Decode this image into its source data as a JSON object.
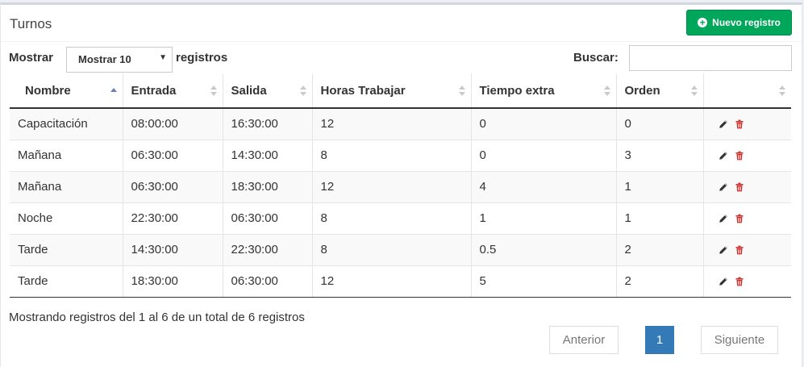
{
  "panel": {
    "title": "Turnos",
    "new_button_label": "Nuevo registro"
  },
  "length": {
    "prefix": "Mostrar",
    "selected": "Mostrar 10",
    "suffix": "registros"
  },
  "search": {
    "label": "Buscar:",
    "value": ""
  },
  "table": {
    "columns": [
      "Nombre",
      "Entrada",
      "Salida",
      "Horas Trabajar",
      "Tiempo extra",
      "Orden",
      ""
    ],
    "sorted_column": "Nombre",
    "sort_direction": "asc",
    "rows": [
      [
        "Capacitación",
        "08:00:00",
        "16:30:00",
        "12",
        "0",
        "0"
      ],
      [
        "Mañana",
        "06:30:00",
        "14:30:00",
        "8",
        "0",
        "3"
      ],
      [
        "Mañana",
        "06:30:00",
        "18:30:00",
        "12",
        "4",
        "1"
      ],
      [
        "Noche",
        "22:30:00",
        "06:30:00",
        "8",
        "1",
        "1"
      ],
      [
        "Tarde",
        "14:30:00",
        "22:30:00",
        "8",
        "0.5",
        "2"
      ],
      [
        "Tarde",
        "18:30:00",
        "06:30:00",
        "12",
        "5",
        "2"
      ]
    ],
    "row_actions": [
      "pencil-icon",
      "trash-icon"
    ]
  },
  "footer": {
    "info": "Mostrando registros del 1 al 6 de un total de 6 registros",
    "prev_label": "Anterior",
    "current_page": "1",
    "next_label": "Siguiente"
  },
  "colors": {
    "success": "#00a65a",
    "primary": "#337ab7",
    "delete": "#c9302c"
  }
}
